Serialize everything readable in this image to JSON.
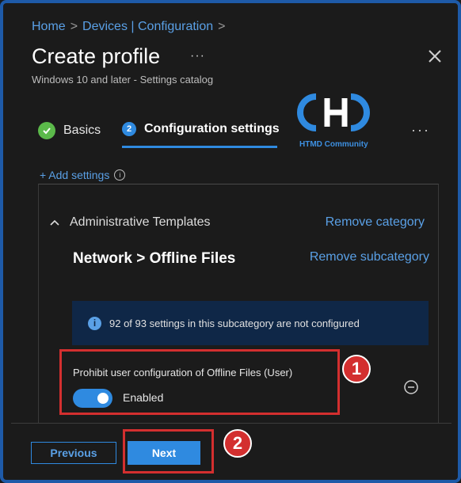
{
  "breadcrumb": [
    "Home",
    "Devices | Configuration"
  ],
  "header": {
    "title": "Create profile",
    "more_label": "···",
    "subtitle": "Windows 10 and later - Settings catalog"
  },
  "watermark": {
    "text": "HTMD Community",
    "logo_letters": "CHD"
  },
  "tabs": [
    {
      "label": "Basics",
      "status": "complete"
    },
    {
      "number": "2",
      "label": "Configuration settings",
      "status": "active"
    }
  ],
  "tabs_more": "···",
  "add_settings": {
    "label": "+ Add settings",
    "info_icon": "info-icon"
  },
  "category": {
    "name": "Administrative Templates",
    "remove_label": "Remove category",
    "subcategory": "Network > Offline Files",
    "remove_sub_label": "Remove subcategory"
  },
  "info_banner": {
    "icon": "i",
    "text": "92 of 93 settings in this subcategory are not configured"
  },
  "setting": {
    "name": "Prohibit user configuration of Offline Files (User)",
    "toggle_label": "Enabled",
    "enabled": true
  },
  "callouts": [
    "1",
    "2"
  ],
  "footer": {
    "previous_label": "Previous",
    "next_label": "Next"
  },
  "colors": {
    "accent": "#2f8ae0",
    "highlight": "#d32f2f",
    "success": "#5bb94a",
    "background": "#1b1b1b"
  }
}
